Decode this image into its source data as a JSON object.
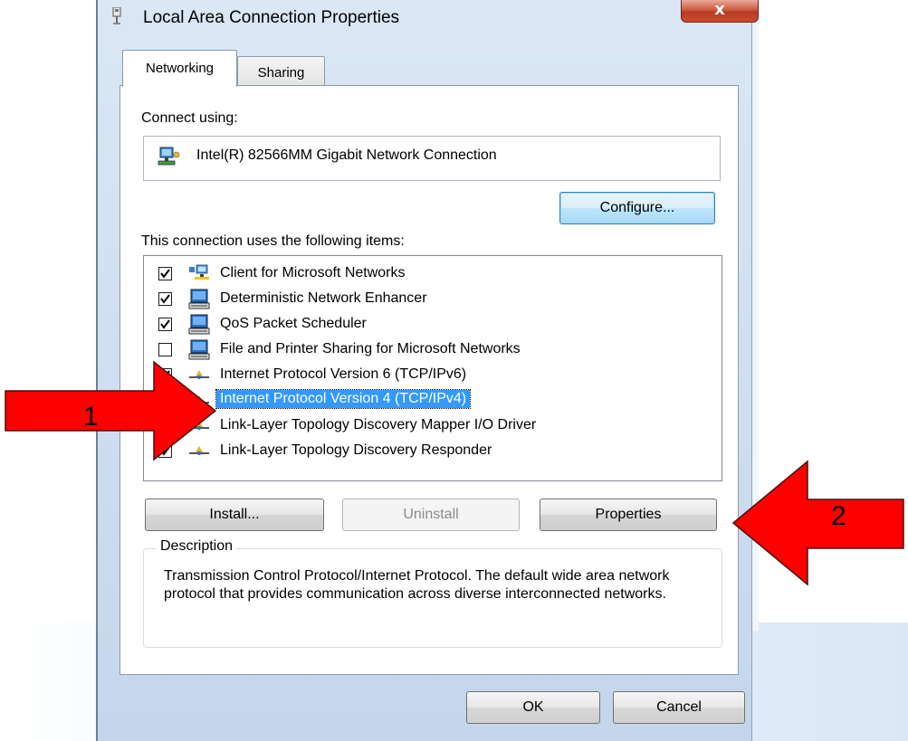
{
  "window": {
    "title": "Local Area Connection Properties",
    "close_label": "x"
  },
  "tabs": [
    {
      "label": "Networking",
      "active": true
    },
    {
      "label": "Sharing",
      "active": false
    }
  ],
  "connect_using_label": "Connect using:",
  "adapter": {
    "name": "Intel(R) 82566MM Gigabit Network Connection",
    "icon": "network-adapter-icon"
  },
  "configure_button": "Configure...",
  "items_label": "This connection uses the following items:",
  "items": [
    {
      "label": "Client for Microsoft Networks",
      "checked": true,
      "icon": "client-network-icon",
      "selected": false
    },
    {
      "label": "Deterministic Network Enhancer",
      "checked": true,
      "icon": "service-computer-icon",
      "selected": false
    },
    {
      "label": "QoS Packet Scheduler",
      "checked": true,
      "icon": "service-computer-icon",
      "selected": false
    },
    {
      "label": "File and Printer Sharing for Microsoft Networks",
      "checked": false,
      "icon": "service-computer-icon",
      "selected": false
    },
    {
      "label": "Internet Protocol Version 6 (TCP/IPv6)",
      "checked": true,
      "icon": "protocol-icon",
      "selected": false
    },
    {
      "label": "Internet Protocol Version 4 (TCP/IPv4)",
      "checked": true,
      "icon": "protocol-icon",
      "selected": true
    },
    {
      "label": "Link-Layer Topology Discovery Mapper I/O Driver",
      "checked": true,
      "icon": "protocol-icon",
      "selected": false
    },
    {
      "label": "Link-Layer Topology Discovery Responder",
      "checked": true,
      "icon": "protocol-icon",
      "selected": false
    }
  ],
  "buttons": {
    "install": "Install...",
    "uninstall": "Uninstall",
    "properties": "Properties",
    "ok": "OK",
    "cancel": "Cancel"
  },
  "description": {
    "legend": "Description",
    "text": "Transmission Control Protocol/Internet Protocol. The default wide area network protocol that provides communication across diverse interconnected networks."
  },
  "annotations": [
    {
      "number": "1",
      "color": "#ff0000",
      "direction": "right"
    },
    {
      "number": "2",
      "color": "#ff0000",
      "direction": "left"
    }
  ],
  "colors": {
    "selection": "#3399ff",
    "arrow": "#ff0000"
  }
}
